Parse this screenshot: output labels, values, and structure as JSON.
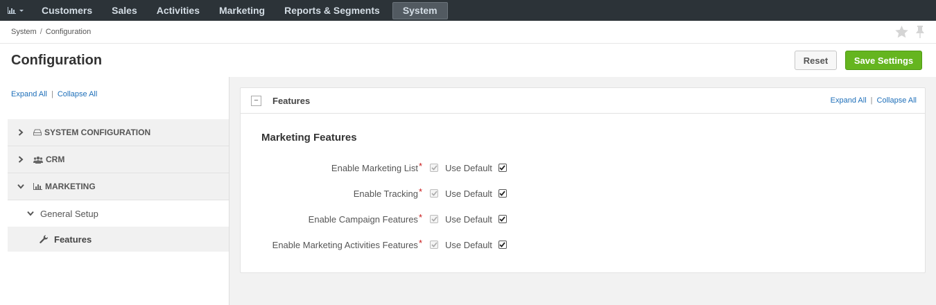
{
  "topnav": {
    "logo_icon": "bar-chart-icon",
    "items": [
      "Customers",
      "Sales",
      "Activities",
      "Marketing",
      "Reports & Segments",
      "System"
    ],
    "active": "System"
  },
  "breadcrumb": [
    "System",
    "Configuration"
  ],
  "page": {
    "title": "Configuration",
    "reset_label": "Reset",
    "save_label": "Save Settings"
  },
  "sidebar": {
    "expand_all": "Expand All",
    "collapse_all": "Collapse All",
    "sections": [
      {
        "label": "SYSTEM CONFIGURATION",
        "icon": "hdd-icon",
        "expanded": false
      },
      {
        "label": "CRM",
        "icon": "group-icon",
        "expanded": false
      },
      {
        "label": "MARKETING",
        "icon": "bar-chart-icon",
        "expanded": true
      }
    ],
    "subgroup": "General Setup",
    "leaf": "Features"
  },
  "panel": {
    "title": "Features",
    "expand_all": "Expand All",
    "collapse_all": "Collapse All",
    "section_title": "Marketing Features",
    "use_default_label": "Use Default",
    "fields": [
      {
        "label": "Enable Marketing List",
        "checked": true,
        "use_default": true
      },
      {
        "label": "Enable Tracking",
        "checked": true,
        "use_default": true
      },
      {
        "label": "Enable Campaign Features",
        "checked": true,
        "use_default": true
      },
      {
        "label": "Enable Marketing Activities Features",
        "checked": true,
        "use_default": true
      }
    ]
  },
  "colors": {
    "nav_bg": "#2c3338",
    "save_green": "#65b51f",
    "link_blue": "#1e6fb9",
    "required_red": "#c81717"
  }
}
